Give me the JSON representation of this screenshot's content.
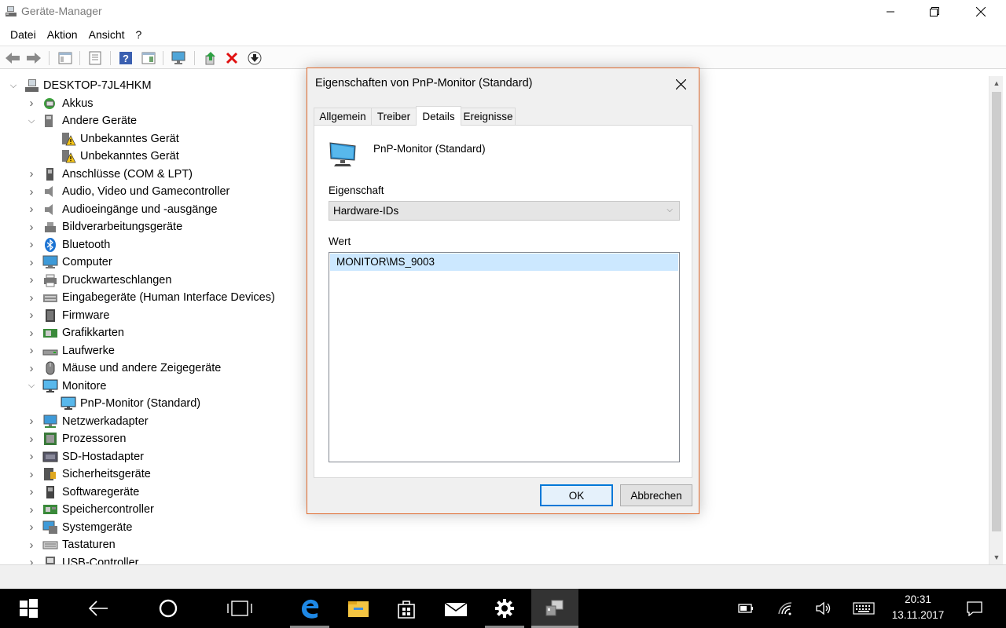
{
  "window": {
    "title": "Geräte-Manager"
  },
  "menu": {
    "items": [
      "Datei",
      "Aktion",
      "Ansicht",
      "?"
    ]
  },
  "tree": {
    "root": "DESKTOP-7JL4HKM",
    "items": [
      {
        "label": "Akkus",
        "icon": "battery-icon",
        "expanded": false
      },
      {
        "label": "Andere Geräte",
        "icon": "unknown-device-icon",
        "expanded": true
      },
      {
        "label": "Unbekanntes Gerät",
        "icon": "warning-device-icon",
        "child": true
      },
      {
        "label": "Unbekanntes Gerät",
        "icon": "warning-device-icon",
        "child": true
      },
      {
        "label": "Anschlüsse (COM & LPT)",
        "icon": "port-icon",
        "expanded": false
      },
      {
        "label": "Audio, Video und Gamecontroller",
        "icon": "speaker-icon",
        "expanded": false
      },
      {
        "label": "Audioeingänge und -ausgänge",
        "icon": "speaker-icon",
        "expanded": false
      },
      {
        "label": "Bildverarbeitungsgeräte",
        "icon": "camera-icon",
        "expanded": false
      },
      {
        "label": "Bluetooth",
        "icon": "bluetooth-icon",
        "expanded": false
      },
      {
        "label": "Computer",
        "icon": "computer-icon",
        "expanded": false
      },
      {
        "label": "Druckwarteschlangen",
        "icon": "printer-icon",
        "expanded": false
      },
      {
        "label": "Eingabegeräte (Human Interface Devices)",
        "icon": "hid-icon",
        "expanded": false
      },
      {
        "label": "Firmware",
        "icon": "firmware-icon",
        "expanded": false
      },
      {
        "label": "Grafikkarten",
        "icon": "graphics-card-icon",
        "expanded": false
      },
      {
        "label": "Laufwerke",
        "icon": "drive-icon",
        "expanded": false
      },
      {
        "label": "Mäuse und andere Zeigegeräte",
        "icon": "mouse-icon",
        "expanded": false
      },
      {
        "label": "Monitore",
        "icon": "monitor-icon",
        "expanded": true
      },
      {
        "label": "PnP-Monitor (Standard)",
        "icon": "monitor-icon",
        "child": true
      },
      {
        "label": "Netzwerkadapter",
        "icon": "network-adapter-icon",
        "expanded": false
      },
      {
        "label": "Prozessoren",
        "icon": "processor-icon",
        "expanded": false
      },
      {
        "label": "SD-Hostadapter",
        "icon": "sd-card-icon",
        "expanded": false
      },
      {
        "label": "Sicherheitsgeräte",
        "icon": "security-device-icon",
        "expanded": false
      },
      {
        "label": "Softwaregeräte",
        "icon": "software-device-icon",
        "expanded": false
      },
      {
        "label": "Speichercontroller",
        "icon": "storage-controller-icon",
        "expanded": false
      },
      {
        "label": "Systemgeräte",
        "icon": "system-device-icon",
        "expanded": false
      },
      {
        "label": "Tastaturen",
        "icon": "keyboard-icon",
        "expanded": false
      },
      {
        "label": "USB-Controller",
        "icon": "usb-icon",
        "expanded": false
      }
    ]
  },
  "dialog": {
    "title": "Eigenschaften von PnP-Monitor (Standard)",
    "tabs": [
      "Allgemein",
      "Treiber",
      "Details",
      "Ereignisse"
    ],
    "active_tab": "Details",
    "device_name": "PnP-Monitor (Standard)",
    "property_label": "Eigenschaft",
    "property_value": "Hardware-IDs",
    "value_label": "Wert",
    "values": [
      "MONITOR\\MS_9003"
    ],
    "ok_label": "OK",
    "cancel_label": "Abbrechen"
  },
  "taskbar": {
    "time": "20:31",
    "date": "13.11.2017"
  },
  "colors": {
    "dialog_border": "#e06a2d",
    "selection": "#cce8ff",
    "default_button_border": "#0078d7",
    "taskbar": "#000000"
  }
}
